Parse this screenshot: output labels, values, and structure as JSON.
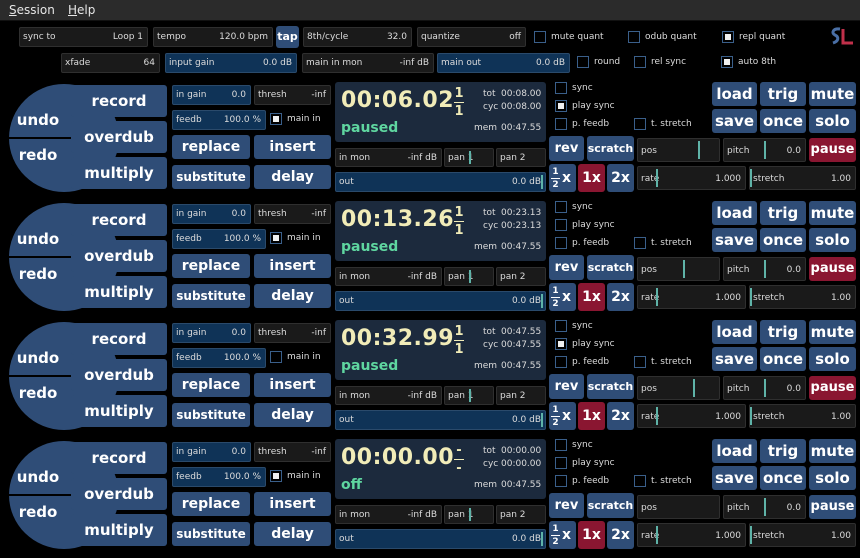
{
  "menu": {
    "session": "ession",
    "session_key": "S",
    "help": "elp",
    "help_key": "H"
  },
  "globals": {
    "sync_to": {
      "label": "sync to",
      "value": "Loop 1"
    },
    "tempo": {
      "label": "tempo",
      "value": "120.0 bpm"
    },
    "tap": "tap",
    "eighth_cycle": {
      "label": "8th/cycle",
      "value": "32.0"
    },
    "quantize": {
      "label": "quantize",
      "value": "off"
    },
    "mute_quant": {
      "label": "mute quant",
      "checked": false
    },
    "odub_quant": {
      "label": "odub quant",
      "checked": false
    },
    "repl_quant": {
      "label": "repl quant",
      "checked": true
    },
    "xfade": {
      "label": "xfade",
      "value": "64"
    },
    "input_gain": {
      "label": "input gain",
      "value": "0.0 dB"
    },
    "main_in_mon": {
      "label": "main in mon",
      "value": "-inf dB"
    },
    "main_out": {
      "label": "main out",
      "value": "0.0 dB"
    },
    "round": {
      "label": "round",
      "checked": false
    },
    "rel_sync": {
      "label": "rel sync",
      "checked": false
    },
    "auto_8th": {
      "label": "auto 8th",
      "checked": true
    }
  },
  "labels": {
    "undo": "undo",
    "redo": "redo",
    "record": "record",
    "overdub": "overdub",
    "multiply": "multiply",
    "in_gain": "in gain",
    "thresh": "thresh",
    "feedb": "feedb",
    "main_in": "main in",
    "replace": "replace",
    "insert": "insert",
    "substitute": "substitute",
    "delay": "delay",
    "tot": "tot",
    "cyc": "cyc",
    "mem": "mem",
    "in_mon": "in mon",
    "pan1": "pan 1",
    "pan2": "pan 2",
    "out": "out",
    "sync": "sync",
    "play_sync": "play sync",
    "p_feedb": "p. feedb",
    "t_stretch": "t. stretch",
    "rev": "rev",
    "scratch": "scratch",
    "half_num": "1",
    "half_den": "2",
    "x": "x",
    "one_x": "1x",
    "two_x": "2x",
    "pos": "pos",
    "pitch": "pitch",
    "rate": "rate",
    "stretch": "stretch",
    "load": "load",
    "trig": "trig",
    "mute": "mute",
    "save": "save",
    "once": "once",
    "solo": "solo",
    "pause": "pause"
  },
  "loops": [
    {
      "time": "00:06.02",
      "num": "1",
      "den": "1",
      "state": "paused",
      "tot": "00:08.00",
      "cyc": "00:08.00",
      "mem": "00:47.55",
      "in_gain": "0.0",
      "thresh": "-inf",
      "feedb": "100.0 %",
      "main_in": true,
      "in_mon": "-inf dB",
      "out": "0.0 dB",
      "sync": false,
      "play_sync": true,
      "p_feedb": false,
      "t_stretch": false,
      "pitch": "0.0",
      "rate": "1.000",
      "stretch": "1.00",
      "pause_active": true,
      "pos_fraction": 0.76
    },
    {
      "time": "00:13.26",
      "num": "1",
      "den": "1",
      "state": "paused",
      "tot": "00:23.13",
      "cyc": "00:23.13",
      "mem": "00:47.55",
      "in_gain": "0.0",
      "thresh": "-inf",
      "feedb": "100.0 %",
      "main_in": true,
      "in_mon": "-inf dB",
      "out": "0.0 dB",
      "sync": false,
      "play_sync": false,
      "p_feedb": false,
      "t_stretch": false,
      "pitch": "0.0",
      "rate": "1.000",
      "stretch": "1.00",
      "pause_active": true,
      "pos_fraction": 0.57
    },
    {
      "time": "00:32.99",
      "num": "1",
      "den": "1",
      "state": "paused",
      "tot": "00:47.55",
      "cyc": "00:47.55",
      "mem": "00:47.55",
      "in_gain": "0.0",
      "thresh": "-inf",
      "feedb": "100.0 %",
      "main_in": false,
      "in_mon": "-inf dB",
      "out": "0.0 dB",
      "sync": false,
      "play_sync": true,
      "p_feedb": false,
      "t_stretch": false,
      "pitch": "0.0",
      "rate": "1.000",
      "stretch": "1.00",
      "pause_active": true,
      "pos_fraction": 0.7
    },
    {
      "time": "00:00.00",
      "num": "-",
      "den": "-",
      "state": "off",
      "tot": "00:00.00",
      "cyc": "00:00.00",
      "mem": "00:47.55",
      "in_gain": "0.0",
      "thresh": "-inf",
      "feedb": "100.0 %",
      "main_in": true,
      "in_mon": "-inf dB",
      "out": "0.0 dB",
      "sync": false,
      "play_sync": false,
      "p_feedb": false,
      "t_stretch": false,
      "pitch": "0.0",
      "rate": "1.000",
      "stretch": "1.00",
      "pause_active": false,
      "pos_fraction": 0
    }
  ],
  "colors": {
    "button": "#2f4d77",
    "pause_active": "#8a1631",
    "time_text": "#f1ecb8",
    "state_text": "#5fd6a0",
    "meter_blue": "#0f3357"
  }
}
